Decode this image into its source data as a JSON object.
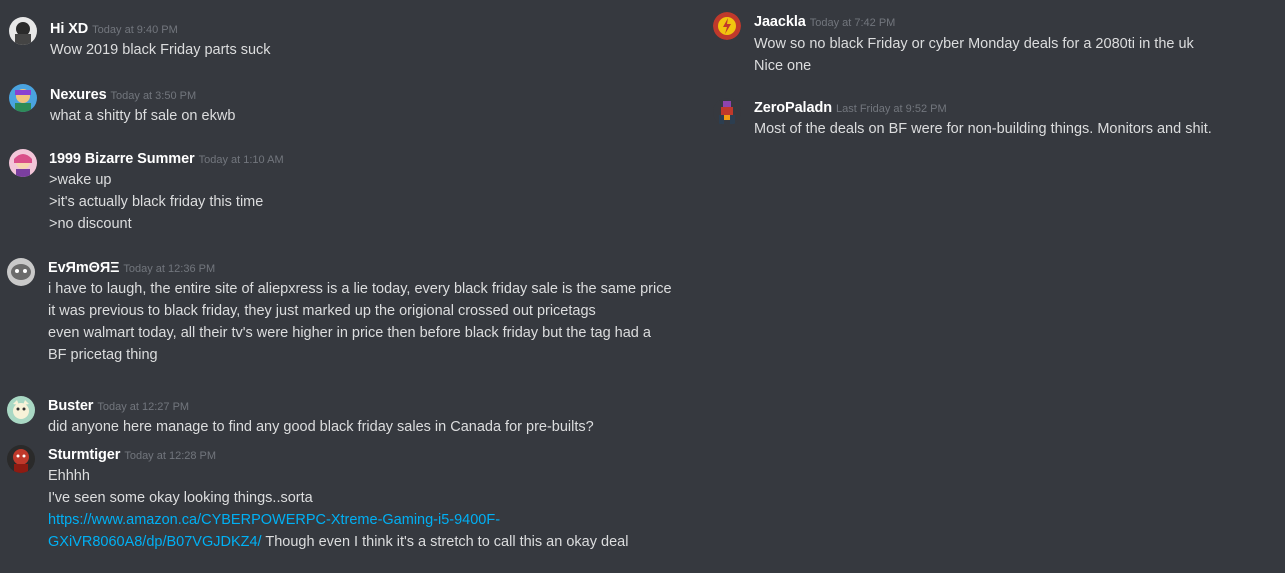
{
  "messages": [
    {
      "author": "Hi XD",
      "timestamp": "Today at 9:40 PM",
      "lines": [
        "Wow 2019 black Friday parts suck"
      ]
    },
    {
      "author": "Nexures",
      "timestamp": "Today at 3:50 PM",
      "lines": [
        "what a shitty bf sale on ekwb"
      ]
    },
    {
      "author": "1999 Bizarre Summer",
      "timestamp": "Today at 1:10 AM",
      "lines": [
        ">wake up",
        ">it's actually black friday this time",
        ">no discount"
      ]
    },
    {
      "author": "EvЯmΘЯΞ",
      "timestamp": "Today at 12:36 PM",
      "lines": [
        "i have to laugh, the entire site of aliepxress is a lie today, every black friday sale is the same price",
        "it was previous to black friday, they just marked up the origional crossed out pricetags",
        "even walmart today, all their tv's were higher in price then before black friday but the tag had a",
        "BF pricetag thing"
      ]
    },
    {
      "author": "Buster",
      "timestamp": "Today at 12:27 PM",
      "lines": [
        "did anyone here manage to find any good black friday sales in Canada for pre-builts?"
      ]
    },
    {
      "author": "Sturmtiger",
      "timestamp": "Today at 12:28 PM",
      "lines": [
        "Ehhhh",
        "I've seen some okay looking things..sorta"
      ],
      "link_line1": "https://www.amazon.ca/CYBERPOWERPC-Xtreme-Gaming-i5-9400F-",
      "link_line2": "GXiVR8060A8/dp/B07VGJDKZ4/",
      "after_link": " Though even I think it's a stretch to call this an okay deal"
    },
    {
      "author": "Jaackla",
      "timestamp": "Today at 7:42 PM",
      "lines": [
        "Wow so no black Friday or cyber Monday deals for a 2080ti in the uk",
        "Nice one"
      ]
    },
    {
      "author": "ZeroPaladn",
      "timestamp": "Last Friday at 9:52 PM",
      "lines": [
        "Most of the deals on BF were for non-building things. Monitors and shit."
      ]
    }
  ]
}
